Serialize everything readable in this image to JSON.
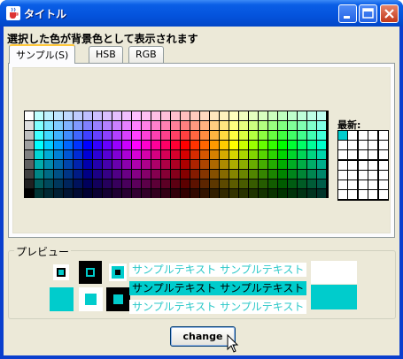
{
  "window": {
    "title": "タイトル"
  },
  "instruction": "選択した色が背景色として表示されます",
  "tabs": [
    {
      "label": "サンプル(S)",
      "selected": true
    },
    {
      "label": "HSB",
      "selected": false
    },
    {
      "label": "RGB",
      "selected": false
    }
  ],
  "swatches": {
    "recent_label": "最新:",
    "recent_colors": [
      "#00cccc"
    ]
  },
  "preview": {
    "title": "プレビュー",
    "sample_text": "サンプルテキスト サンプルテキスト",
    "color": "#2bc8c8"
  },
  "change_button": {
    "label": "change"
  },
  "icons": {
    "app": "java-cup-icon",
    "minimize": "minimize-icon",
    "maximize": "maximize-icon",
    "close": "close-icon",
    "cursor": "mouse-pointer-icon"
  }
}
